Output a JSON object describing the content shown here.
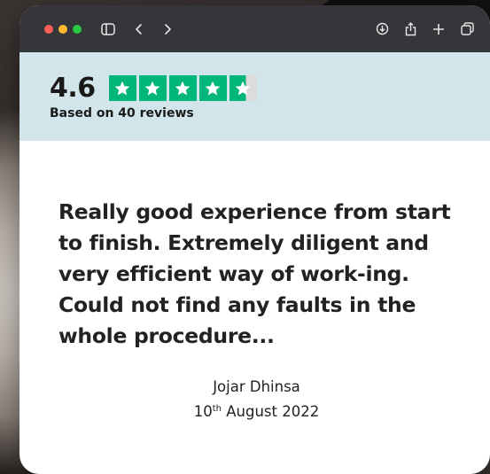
{
  "colors": {
    "titlebar": "#343639",
    "close": "#ff5f57",
    "minimize": "#febc2e",
    "zoom": "#28c840",
    "rating_band": "#d2e5ea",
    "star_green": "#00b67a"
  },
  "toolbar": {
    "icons": [
      "sidebar-icon",
      "back-icon",
      "forward-icon",
      "download-icon",
      "share-icon",
      "new-tab-icon",
      "tabs-overview-icon"
    ]
  },
  "rating": {
    "score": "4.6",
    "stars_filled": 4.6,
    "stars_total": 5,
    "based_on": "Based on 40 reviews"
  },
  "review": {
    "text": "Really good experience from start to finish. Extremely diligent and very efficient way of work-ing. Could not find any faults in the whole procedure...",
    "author": "Jojar Dhinsa",
    "date_day": "10",
    "date_suffix": "th",
    "date_rest": " August 2022"
  }
}
